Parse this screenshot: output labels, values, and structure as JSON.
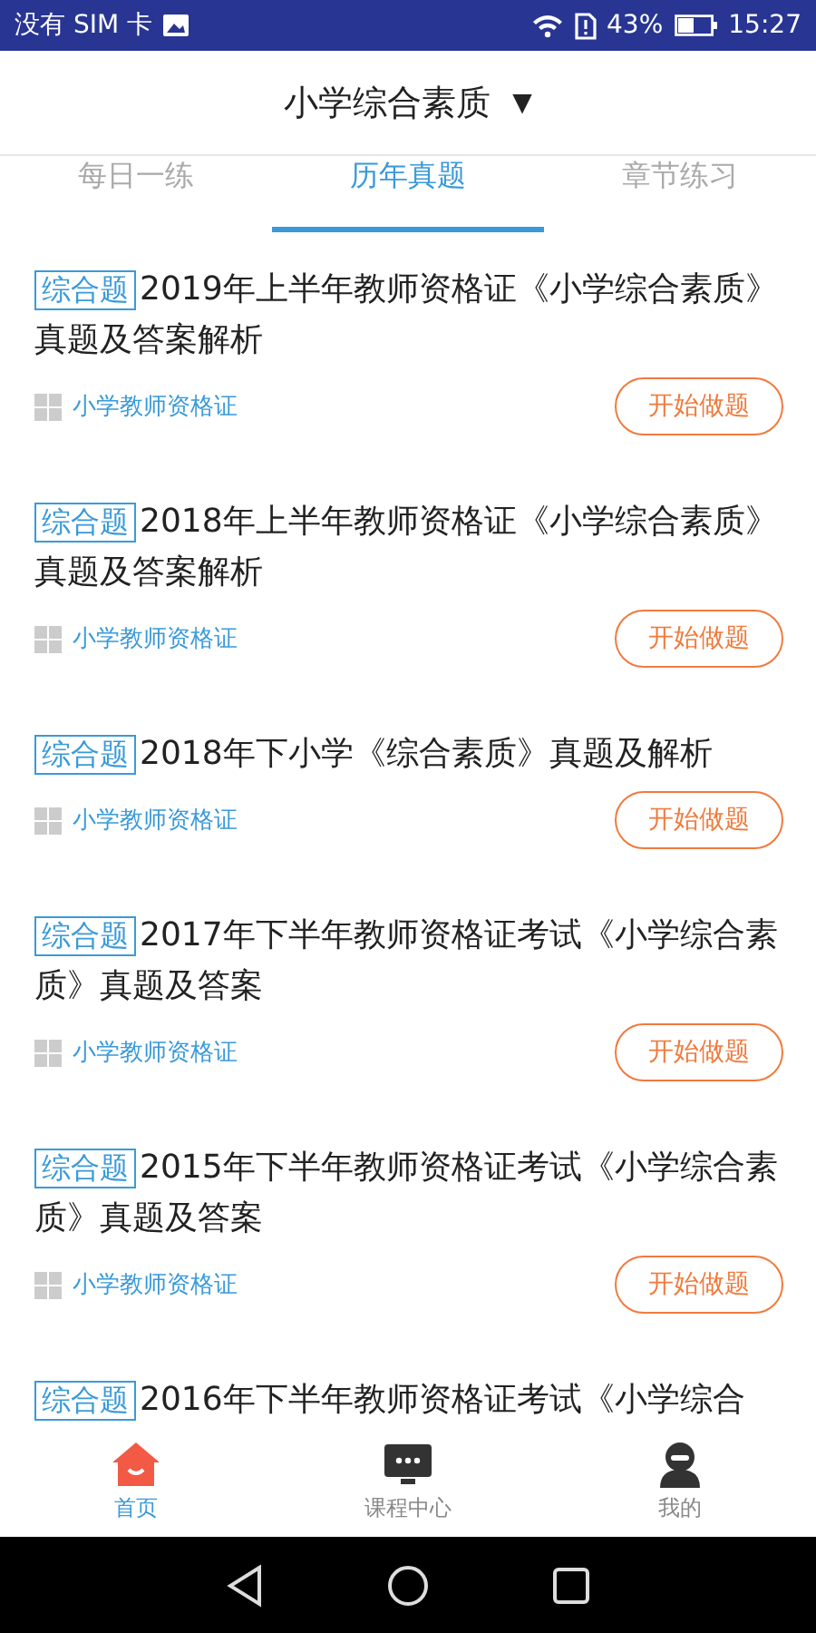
{
  "status_bar": {
    "carrier": "没有 SIM 卡",
    "battery": "43%",
    "time": "15:27"
  },
  "header": {
    "title": "小学综合素质",
    "caret": "▼"
  },
  "tabs": [
    {
      "label": "每日一练",
      "selected": false
    },
    {
      "label": "历年真题",
      "selected": true
    },
    {
      "label": "章节练习",
      "selected": false
    }
  ],
  "items": [
    {
      "tag": "综合题",
      "title": "2019年上半年教师资格证《小学综合素质》真题及答案解析",
      "category": "小学教师资格证",
      "action": "开始做题"
    },
    {
      "tag": "综合题",
      "title": "2018年上半年教师资格证《小学综合素质》真题及答案解析",
      "category": "小学教师资格证",
      "action": "开始做题"
    },
    {
      "tag": "综合题",
      "title": "2018年下小学《综合素质》真题及解析",
      "category": "小学教师资格证",
      "action": "开始做题"
    },
    {
      "tag": "综合题",
      "title": "2017年下半年教师资格证考试《小学综合素质》真题及答案",
      "category": "小学教师资格证",
      "action": "开始做题"
    },
    {
      "tag": "综合题",
      "title": "2015年下半年教师资格证考试《小学综合素质》真题及答案",
      "category": "小学教师资格证",
      "action": "开始做题"
    },
    {
      "tag": "综合题",
      "title": "2016年下半年教师资格证考试《小学综合"
    }
  ],
  "bottom_nav": [
    {
      "kind": "home",
      "label": "首页",
      "selected": true
    },
    {
      "kind": "courses",
      "label": "课程中心",
      "selected": false
    },
    {
      "kind": "profile",
      "label": "我的",
      "selected": false
    }
  ]
}
